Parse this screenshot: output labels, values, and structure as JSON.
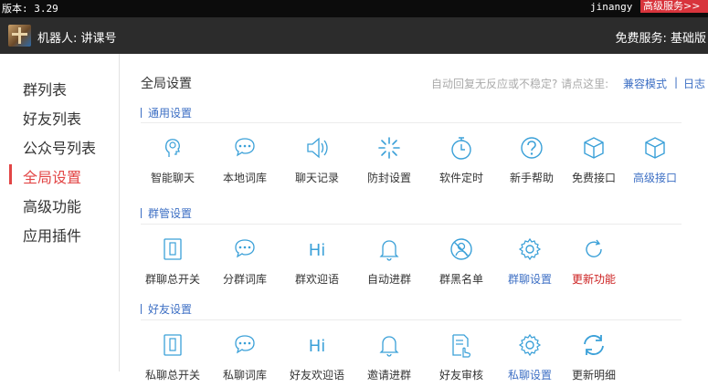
{
  "topbar": {
    "version": "版本: 3.29",
    "user": "jinangy",
    "vip_label": "高级服务>>"
  },
  "header": {
    "robot": "机器人: 讲课号",
    "service": "免费服务: 基础版"
  },
  "sidebar": {
    "items": [
      {
        "label": "群列表"
      },
      {
        "label": "好友列表"
      },
      {
        "label": "公众号列表"
      },
      {
        "label": "全局设置",
        "active": true
      },
      {
        "label": "高级功能"
      },
      {
        "label": "应用插件"
      }
    ]
  },
  "main": {
    "title": "全局设置",
    "hint": "自动回复无反应或不稳定? 请点这里:",
    "compat_link": "兼容模式",
    "separator": "|",
    "log_link": "日志"
  },
  "sections": [
    {
      "title": "通用设置",
      "items": [
        {
          "label": "智能聊天",
          "icon": "brain-head-icon"
        },
        {
          "label": "本地词库",
          "icon": "chat-bubble-icon"
        },
        {
          "label": "聊天记录",
          "icon": "speaker-icon"
        },
        {
          "label": "防封设置",
          "icon": "loading-spinner-icon"
        },
        {
          "label": "软件定时",
          "icon": "stopwatch-icon"
        },
        {
          "label": "新手帮助",
          "icon": "question-icon"
        },
        {
          "label": "免费接口",
          "icon": "cube-icon"
        },
        {
          "label": "高级接口",
          "icon": "cube-icon",
          "style": "blue"
        }
      ]
    },
    {
      "title": "群管设置",
      "items": [
        {
          "label": "群聊总开关",
          "icon": "switch-icon"
        },
        {
          "label": "分群词库",
          "icon": "chat-bubble-icon"
        },
        {
          "label": "群欢迎语",
          "icon": "hi-icon",
          "glyph": "Hi"
        },
        {
          "label": "自动进群",
          "icon": "bell-icon"
        },
        {
          "label": "群黑名单",
          "icon": "block-user-icon"
        },
        {
          "label": "群聊设置",
          "icon": "gear-icon",
          "style": "blue"
        },
        {
          "label": "更新功能",
          "icon": "refresh-icon",
          "style": "red"
        }
      ]
    },
    {
      "title": "好友设置",
      "items": [
        {
          "label": "私聊总开关",
          "icon": "switch-icon"
        },
        {
          "label": "私聊词库",
          "icon": "chat-bubble-icon"
        },
        {
          "label": "好友欢迎语",
          "icon": "hi-icon",
          "glyph": "Hi"
        },
        {
          "label": "邀请进群",
          "icon": "bell-icon"
        },
        {
          "label": "好友审核",
          "icon": "document-hand-icon"
        },
        {
          "label": "私聊设置",
          "icon": "gear-icon",
          "style": "blue"
        },
        {
          "label": "更新明细",
          "icon": "sync-icon"
        }
      ]
    }
  ],
  "colors": {
    "accent": "#3d6fc4",
    "icon": "#3aa0d8",
    "active": "#e24545",
    "header": "#2c2c2c"
  }
}
